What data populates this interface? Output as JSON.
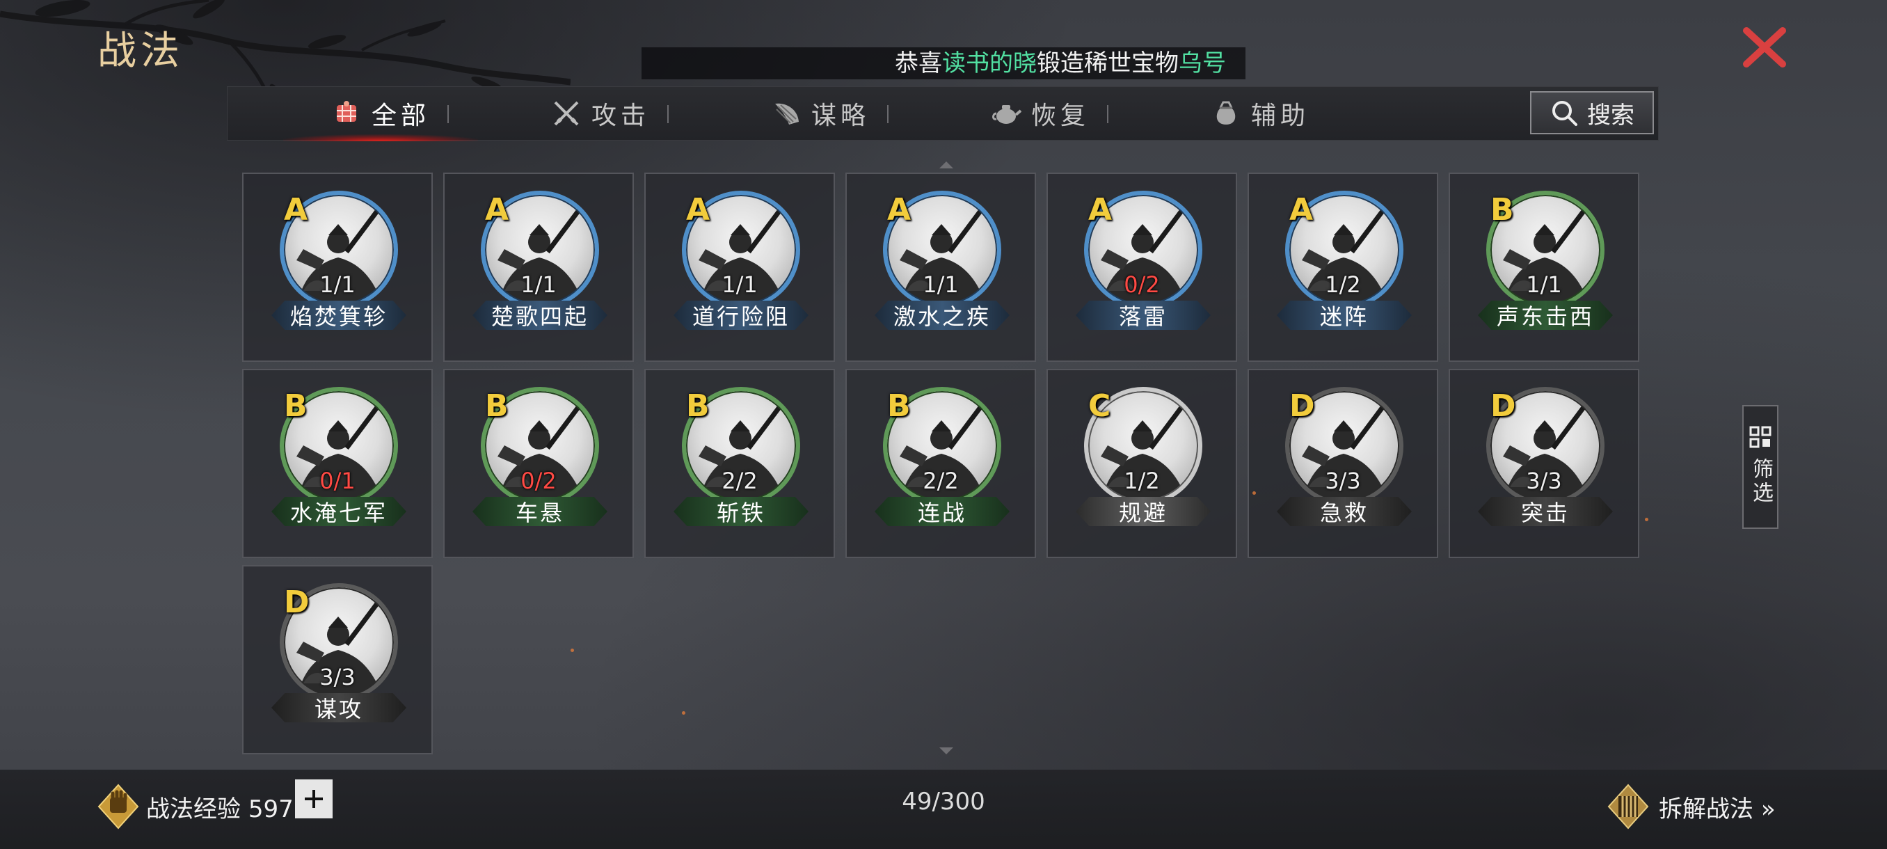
{
  "header": {
    "title": "战法",
    "announcement": {
      "prefix": "恭喜",
      "player": "读书的晓",
      "middle": "锻造稀世宝物",
      "item": "乌号"
    }
  },
  "tabs": [
    {
      "label": "全部",
      "icon": "bundle-icon",
      "active": true
    },
    {
      "label": "攻击",
      "icon": "crossed-swords-icon",
      "active": false
    },
    {
      "label": "谋略",
      "icon": "feather-fan-icon",
      "active": false
    },
    {
      "label": "恢复",
      "icon": "teapot-icon",
      "active": false
    },
    {
      "label": "辅助",
      "icon": "pouch-icon",
      "active": false
    }
  ],
  "search": {
    "label": "搜索"
  },
  "tactics": [
    {
      "grade": "A",
      "count": "1/1",
      "name": "焰焚箕轸",
      "red": false
    },
    {
      "grade": "A",
      "count": "1/1",
      "name": "楚歌四起",
      "red": false
    },
    {
      "grade": "A",
      "count": "1/1",
      "name": "道行险阻",
      "red": false
    },
    {
      "grade": "A",
      "count": "1/1",
      "name": "激水之疾",
      "red": false
    },
    {
      "grade": "A",
      "count": "0/2",
      "name": "落雷",
      "red": true
    },
    {
      "grade": "A",
      "count": "1/2",
      "name": "迷阵",
      "red": false
    },
    {
      "grade": "B",
      "count": "1/1",
      "name": "声东击西",
      "red": false
    },
    {
      "grade": "B",
      "count": "0/1",
      "name": "水淹七军",
      "red": true
    },
    {
      "grade": "B",
      "count": "0/2",
      "name": "车悬",
      "red": true
    },
    {
      "grade": "B",
      "count": "2/2",
      "name": "斩铁",
      "red": false
    },
    {
      "grade": "B",
      "count": "2/2",
      "name": "连战",
      "red": false
    },
    {
      "grade": "C",
      "count": "1/2",
      "name": "规避",
      "red": false
    },
    {
      "grade": "D",
      "count": "3/3",
      "name": "急救",
      "red": false
    },
    {
      "grade": "D",
      "count": "3/3",
      "name": "突击",
      "red": false
    },
    {
      "grade": "D",
      "count": "3/3",
      "name": "谋攻",
      "red": false
    }
  ],
  "filter": {
    "label": "筛选"
  },
  "footer": {
    "exp_label": "战法经验",
    "exp_value": "597",
    "capacity": "49/300",
    "disassemble_label": "拆解战法",
    "disassemble_arrow": "»"
  },
  "colors": {
    "highlight_green": "#52e0a2",
    "grade_gold": "#f2cc3c",
    "red_count": "#ff4a44",
    "close_red": "#d94040"
  }
}
